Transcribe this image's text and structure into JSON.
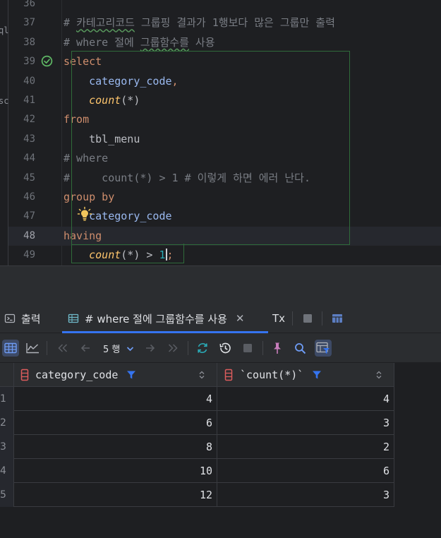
{
  "editor": {
    "left_strip": [
      "ql",
      "sc"
    ],
    "lines": [
      {
        "no": "36",
        "tokens": []
      },
      {
        "no": "37",
        "tokens": [
          {
            "t": "# ",
            "c": "cmt"
          },
          {
            "t": "카테고리코드",
            "c": "cmt squig"
          },
          {
            "t": " 그룹핑 결과가 1행보다 많은 그룹만 출력",
            "c": "cmt"
          }
        ]
      },
      {
        "no": "38",
        "tokens": [
          {
            "t": "# where 절에 ",
            "c": "cmt"
          },
          {
            "t": "그룹함수를",
            "c": "cmt squig"
          },
          {
            "t": " 사용",
            "c": "cmt"
          }
        ]
      },
      {
        "no": "39",
        "tokens": [
          {
            "t": "select",
            "c": "kw"
          }
        ]
      },
      {
        "no": "40",
        "tokens": [
          {
            "t": "    ",
            "c": "plain"
          },
          {
            "t": "category_code",
            "c": "col"
          },
          {
            "t": ",",
            "c": "kw"
          }
        ]
      },
      {
        "no": "41",
        "tokens": [
          {
            "t": "    ",
            "c": "plain"
          },
          {
            "t": "count",
            "c": "fn-italic"
          },
          {
            "t": "(*)",
            "c": "plain"
          }
        ]
      },
      {
        "no": "42",
        "tokens": [
          {
            "t": "from",
            "c": "kw"
          }
        ]
      },
      {
        "no": "43",
        "tokens": [
          {
            "t": "    tbl_menu",
            "c": "plain"
          }
        ]
      },
      {
        "no": "44",
        "tokens": [
          {
            "t": "# where",
            "c": "cmt"
          }
        ]
      },
      {
        "no": "45",
        "tokens": [
          {
            "t": "#     count(*) > 1 # 이렇게 하면 에러 난다.",
            "c": "cmt"
          }
        ]
      },
      {
        "no": "46",
        "tokens": [
          {
            "t": "group by",
            "c": "kw"
          }
        ]
      },
      {
        "no": "47",
        "tokens": [
          {
            "t": "    ",
            "c": "plain"
          },
          {
            "t": "category_code",
            "c": "col"
          }
        ]
      },
      {
        "no": "48",
        "tokens": [
          {
            "t": "having",
            "c": "kw"
          }
        ]
      },
      {
        "no": "49",
        "tokens": [
          {
            "t": "    ",
            "c": "plain"
          },
          {
            "t": "count",
            "c": "fn-italic"
          },
          {
            "t": "(*)",
            "c": "plain"
          },
          {
            "t": " > ",
            "c": "plain"
          },
          {
            "t": "1",
            "c": "num"
          },
          {
            "t": "CARET",
            "c": "caret"
          },
          {
            "t": ";",
            "c": "kw"
          }
        ]
      }
    ]
  },
  "tabs": [
    {
      "label": "출력",
      "icon": "console-icon"
    },
    {
      "label": "# where 절에 그룹함수를 사용",
      "icon": "table-icon",
      "active": true
    },
    {
      "label": "Tx",
      "icon": ""
    }
  ],
  "toolbar": {
    "page_label": "5 행"
  },
  "grid": {
    "columns": [
      "category_code",
      "`count(*)`"
    ],
    "rows": [
      {
        "n": "1",
        "values": [
          "4",
          "4"
        ]
      },
      {
        "n": "2",
        "values": [
          "6",
          "3"
        ]
      },
      {
        "n": "3",
        "values": [
          "8",
          "2"
        ]
      },
      {
        "n": "4",
        "values": [
          "10",
          "6"
        ]
      },
      {
        "n": "5",
        "values": [
          "12",
          "3"
        ]
      }
    ]
  },
  "colors": {
    "accent": "#3574f0",
    "keyword": "#cf8e6d",
    "column": "#9ab9f0",
    "function": "#ffc66d",
    "comment": "#7a7e85",
    "number": "#2aacb8"
  }
}
